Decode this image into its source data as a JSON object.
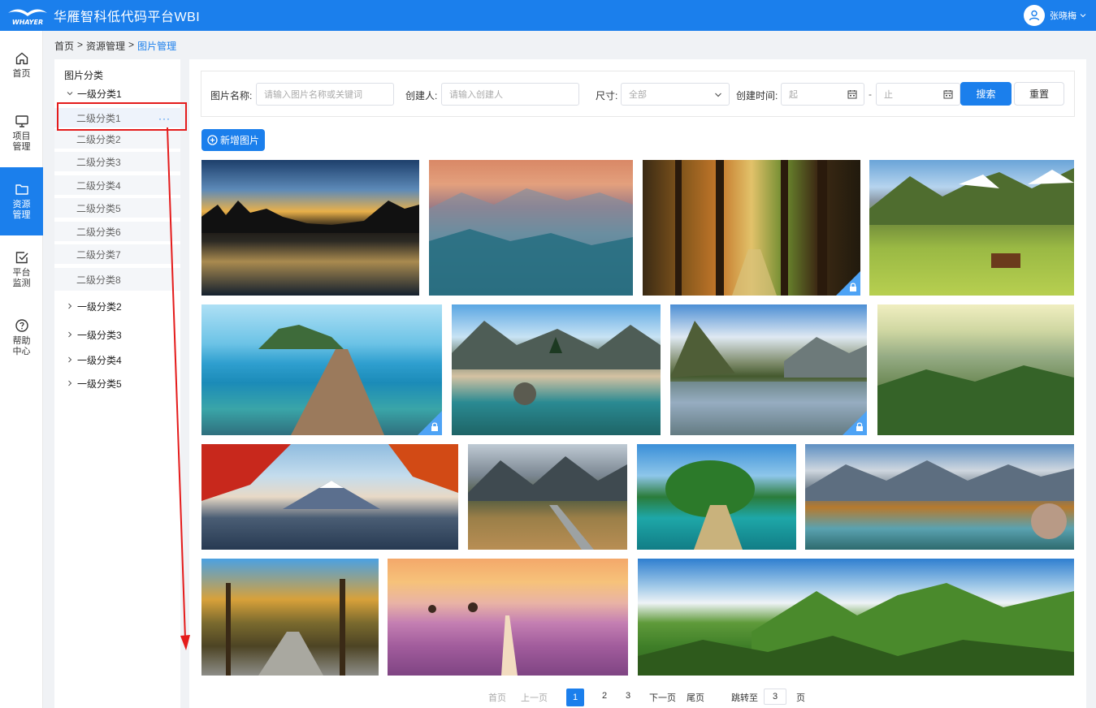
{
  "header": {
    "logo_text": "WHAYER",
    "app_title": "华雁智科低代码平台WBI",
    "user_name": "张晓梅"
  },
  "nav": {
    "items": [
      {
        "label": "首页",
        "icon": "home-icon"
      },
      {
        "label": "项目管理",
        "icon": "monitor-icon"
      },
      {
        "label": "资源管理",
        "icon": "folder-icon",
        "active": true
      },
      {
        "label": "平台监测",
        "icon": "check-square-icon"
      },
      {
        "label": "帮助中心",
        "icon": "help-circle-icon"
      }
    ]
  },
  "breadcrumb": {
    "home": "首页",
    "sep1": ">",
    "parent": "资源管理",
    "sep2": ">",
    "current": "图片管理"
  },
  "tree": {
    "title": "图片分类",
    "level1": [
      "一级分类1",
      "一级分类2",
      "一级分类3",
      "一级分类4",
      "一级分类5"
    ],
    "level2": [
      "二级分类1",
      "二级分类2",
      "二级分类3",
      "二级分类4",
      "二级分类5",
      "二级分类6",
      "二级分类7",
      "二级分类8"
    ],
    "more": "···"
  },
  "filters": {
    "name_label": "图片名称:",
    "name_placeholder": "请输入图片名称或关键词",
    "creator_label": "创建人:",
    "creator_placeholder": "请输入创建人",
    "size_label": "尺寸:",
    "size_value": "全部",
    "time_label": "创建时间:",
    "time_start": "起",
    "time_sep": "-",
    "time_end": "止",
    "search_button": "搜索",
    "reset_button": "重置"
  },
  "add_button": "新增图片",
  "pagination": {
    "first": "首页",
    "prev": "上一页",
    "pages": [
      "1",
      "2",
      "3"
    ],
    "current": "1",
    "next": "下一页",
    "last": "尾页",
    "jump_label": "跳转至",
    "jump_value": "3",
    "page_suffix": "页"
  },
  "colors": {
    "primary": "#1b7fec",
    "highlight": "#e41b1b"
  }
}
